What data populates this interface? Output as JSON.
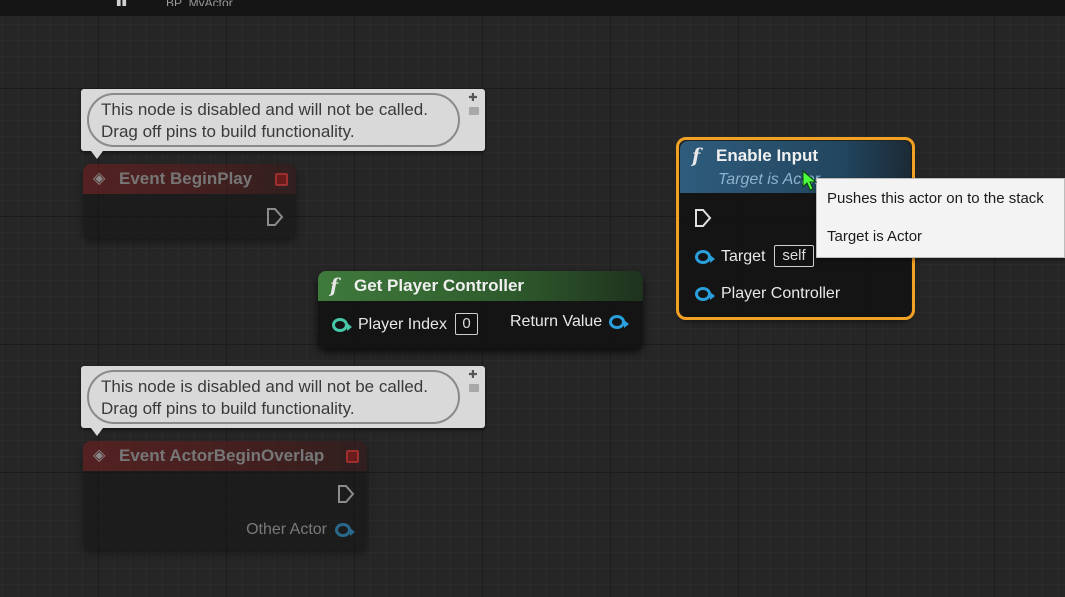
{
  "topbar": {
    "crumb_text": "BP_MyActor"
  },
  "comments": [
    {
      "line1": "This node is disabled and will not be called.",
      "line2": "Drag off pins to build functionality."
    },
    {
      "line1": "This node is disabled and will not be called.",
      "line2": "Drag off pins to build functionality."
    }
  ],
  "event_begin_play": {
    "title": "Event BeginPlay"
  },
  "event_actor_overlap": {
    "title": "Event ActorBeginOverlap",
    "output_pin": "Other Actor"
  },
  "get_player_controller": {
    "title": "Get Player Controller",
    "input_pin": "Player Index",
    "input_value": "0",
    "output_pin": "Return Value"
  },
  "enable_input": {
    "title": "Enable Input",
    "subtitle": "Target is Actor",
    "target_pin": "Target",
    "target_value": "self",
    "controller_pin": "Player Controller"
  },
  "tooltip": {
    "line1": "Pushes this actor on to the stack",
    "line2": "Target is Actor"
  },
  "colors": {
    "event_header": "#7a1e1e",
    "pure_header": "#3f7a3c",
    "impure_header": "#2f5c7d",
    "selection": "#f1a222",
    "object_pin": "#2a9fdc",
    "int_pin": "#46c7a8"
  },
  "icons": {
    "function": "function-f-icon",
    "event": "event-diamond-icon",
    "exec": "exec-pin-icon"
  }
}
